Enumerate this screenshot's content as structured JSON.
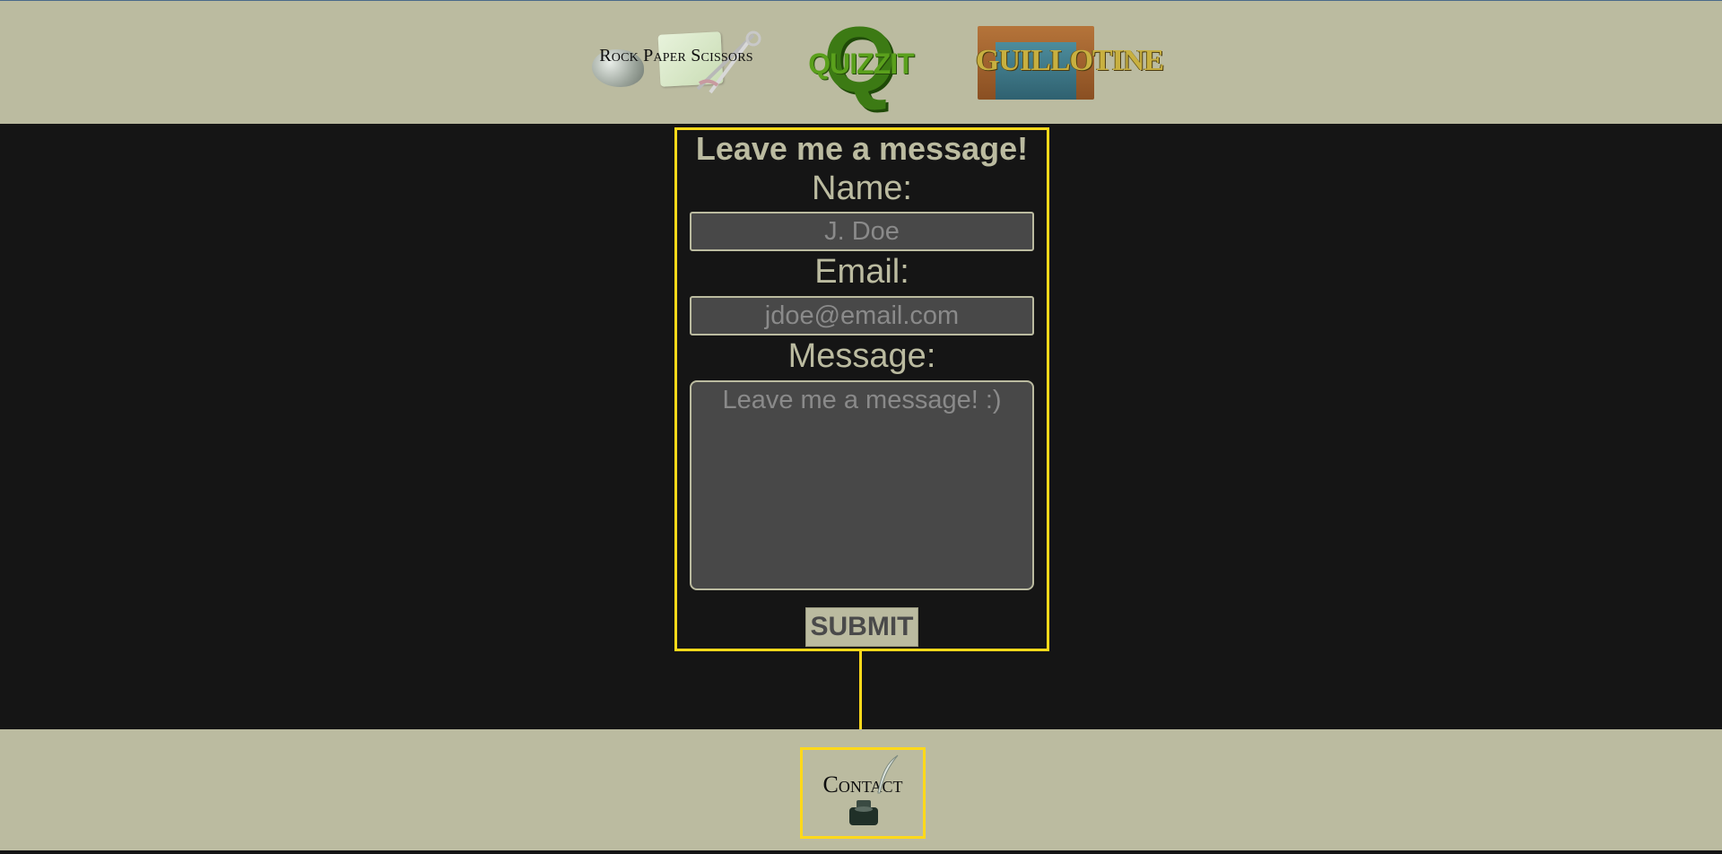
{
  "nav": {
    "games": [
      {
        "label": "Rock Paper Scissors",
        "icon": "rock-paper-scissors-logo"
      },
      {
        "label": "QUIZZIT",
        "icon": "quizzit-logo"
      },
      {
        "label": "GUILLOTINE",
        "icon": "guillotine-logo"
      }
    ]
  },
  "form": {
    "title": "Leave me a message!",
    "name_label": "Name:",
    "name_placeholder": "J. Doe",
    "email_label": "Email:",
    "email_placeholder": "jdoe@email.com",
    "message_label": "Message:",
    "message_placeholder": "Leave me a message! :)",
    "submit_label": "SUBMIT"
  },
  "footer": {
    "contact_label": "Contact",
    "contact_icon": "quill-inkwell-icon"
  },
  "colors": {
    "background_light": "#bbbba0",
    "background_dark": "#151515",
    "highlight": "#ffd91a",
    "input_bg": "#484848"
  }
}
